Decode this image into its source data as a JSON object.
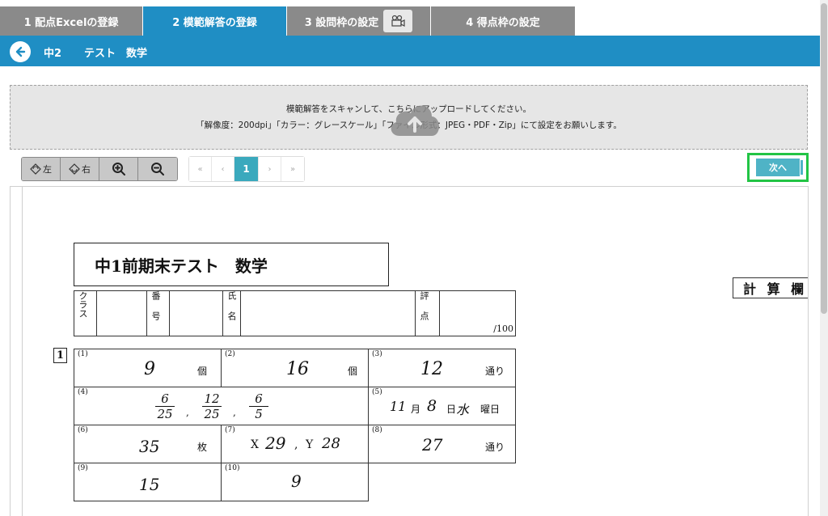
{
  "tabs": [
    {
      "label": "1 配点Excelの登録"
    },
    {
      "label": "2 模範解答の登録"
    },
    {
      "label": "3 設問枠の設定"
    },
    {
      "label": "4 得点枠の設定"
    }
  ],
  "header": {
    "grade": "中2",
    "subject": "テスト　数学"
  },
  "upload": {
    "line1": "模範解答をスキャンして、こちらにアップロードしてください。",
    "line2": "「解像度：200dpi」「カラー：グレースケール」「ファイル形式：JPEG・PDF・Zip」にて設定をお願いします。"
  },
  "toolbar": {
    "rotate_left": "左",
    "rotate_right": "右"
  },
  "pager": {
    "first": "«",
    "prev": "‹",
    "current": "1",
    "next": "›",
    "last": "»"
  },
  "next_button": "次へ",
  "document": {
    "title": "中1前期末テスト　数学",
    "calc_label": "計 算 欄",
    "info": {
      "class_label": "クラス",
      "number_label": "番号",
      "name_label": "氏名",
      "score_label": "評点",
      "score_total": "/100"
    },
    "question_number": "1",
    "answers": [
      {
        "num": "(1)",
        "answer": "9",
        "unit": "個"
      },
      {
        "num": "(2)",
        "answer": "16",
        "unit": "個"
      },
      {
        "num": "(3)",
        "answer": "12",
        "unit": "通り"
      },
      {
        "num": "(4)",
        "fractions": [
          {
            "n": "6",
            "d": "25"
          },
          {
            "n": "12",
            "d": "25"
          },
          {
            "n": "6",
            "d": "5"
          }
        ],
        "separator": ","
      },
      {
        "num": "(5)",
        "answer_month": "11",
        "month_label": "月",
        "answer_day": "8",
        "day_label": "日",
        "answer_weekday": "水",
        "weekday_label": "曜日"
      },
      {
        "num": "(6)",
        "answer": "35",
        "unit": "枚"
      },
      {
        "num": "(7)",
        "x_label": "X",
        "x_value": "29",
        "comma": ",",
        "y_label": "Y",
        "y_value": "28"
      },
      {
        "num": "(8)",
        "answer": "27",
        "unit": "通り"
      },
      {
        "num": "(9)",
        "answer": "15"
      },
      {
        "num": "(10)",
        "answer": "9"
      }
    ]
  }
}
